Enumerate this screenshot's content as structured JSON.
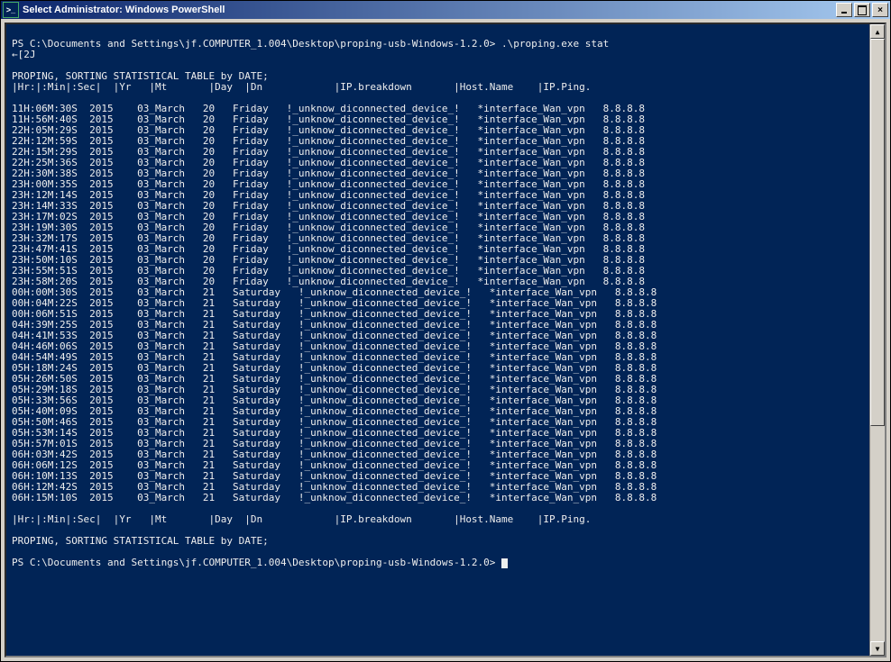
{
  "window": {
    "title": "Select Administrator: Windows PowerShell",
    "icon_text": ">_"
  },
  "prompt1": "PS C:\\Documents and Settings\\jf.COMPUTER_1.004\\Desktop\\proping-usb-Windows-1.2.0> .\\proping.exe stat",
  "esc": "←[2J",
  "header": "PROPING, SORTING STATISTICAL TABLE by DATE;",
  "colhdr": "|Hr:|:Min|:Sec|  |Yr   |Mt       |Day  |Dn            |IP.breakdown       |Host.Name    |IP.Ping.",
  "rows_friday": [
    {
      "t": "11H:06M:30S",
      "y": "2015",
      "m": "03_March",
      "d": "20",
      "dn": "Friday",
      "bd": "!_unknow_diconnected_device_!",
      "hn": "*interface_Wan_vpn",
      "ip": "8.8.8.8"
    },
    {
      "t": "11H:56M:40S",
      "y": "2015",
      "m": "03_March",
      "d": "20",
      "dn": "Friday",
      "bd": "!_unknow_diconnected_device_!",
      "hn": "*interface_Wan_vpn",
      "ip": "8.8.8.8"
    },
    {
      "t": "22H:05M:29S",
      "y": "2015",
      "m": "03_March",
      "d": "20",
      "dn": "Friday",
      "bd": "!_unknow_diconnected_device_!",
      "hn": "*interface_Wan_vpn",
      "ip": "8.8.8.8"
    },
    {
      "t": "22H:12M:59S",
      "y": "2015",
      "m": "03_March",
      "d": "20",
      "dn": "Friday",
      "bd": "!_unknow_diconnected_device_!",
      "hn": "*interface_Wan_vpn",
      "ip": "8.8.8.8"
    },
    {
      "t": "22H:15M:29S",
      "y": "2015",
      "m": "03_March",
      "d": "20",
      "dn": "Friday",
      "bd": "!_unknow_diconnected_device_!",
      "hn": "*interface_Wan_vpn",
      "ip": "8.8.8.8"
    },
    {
      "t": "22H:25M:36S",
      "y": "2015",
      "m": "03_March",
      "d": "20",
      "dn": "Friday",
      "bd": "!_unknow_diconnected_device_!",
      "hn": "*interface_Wan_vpn",
      "ip": "8.8.8.8"
    },
    {
      "t": "22H:30M:38S",
      "y": "2015",
      "m": "03_March",
      "d": "20",
      "dn": "Friday",
      "bd": "!_unknow_diconnected_device_!",
      "hn": "*interface_Wan_vpn",
      "ip": "8.8.8.8"
    },
    {
      "t": "23H:00M:35S",
      "y": "2015",
      "m": "03_March",
      "d": "20",
      "dn": "Friday",
      "bd": "!_unknow_diconnected_device_!",
      "hn": "*interface_Wan_vpn",
      "ip": "8.8.8.8"
    },
    {
      "t": "23H:12M:14S",
      "y": "2015",
      "m": "03_March",
      "d": "20",
      "dn": "Friday",
      "bd": "!_unknow_diconnected_device_!",
      "hn": "*interface_Wan_vpn",
      "ip": "8.8.8.8"
    },
    {
      "t": "23H:14M:33S",
      "y": "2015",
      "m": "03_March",
      "d": "20",
      "dn": "Friday",
      "bd": "!_unknow_diconnected_device_!",
      "hn": "*interface_Wan_vpn",
      "ip": "8.8.8.8"
    },
    {
      "t": "23H:17M:02S",
      "y": "2015",
      "m": "03_March",
      "d": "20",
      "dn": "Friday",
      "bd": "!_unknow_diconnected_device_!",
      "hn": "*interface_Wan_vpn",
      "ip": "8.8.8.8"
    },
    {
      "t": "23H:19M:30S",
      "y": "2015",
      "m": "03_March",
      "d": "20",
      "dn": "Friday",
      "bd": "!_unknow_diconnected_device_!",
      "hn": "*interface_Wan_vpn",
      "ip": "8.8.8.8"
    },
    {
      "t": "23H:32M:17S",
      "y": "2015",
      "m": "03_March",
      "d": "20",
      "dn": "Friday",
      "bd": "!_unknow_diconnected_device_!",
      "hn": "*interface_Wan_vpn",
      "ip": "8.8.8.8"
    },
    {
      "t": "23H:47M:41S",
      "y": "2015",
      "m": "03_March",
      "d": "20",
      "dn": "Friday",
      "bd": "!_unknow_diconnected_device_!",
      "hn": "*interface_Wan_vpn",
      "ip": "8.8.8.8"
    },
    {
      "t": "23H:50M:10S",
      "y": "2015",
      "m": "03_March",
      "d": "20",
      "dn": "Friday",
      "bd": "!_unknow_diconnected_device_!",
      "hn": "*interface_Wan_vpn",
      "ip": "8.8.8.8"
    },
    {
      "t": "23H:55M:51S",
      "y": "2015",
      "m": "03_March",
      "d": "20",
      "dn": "Friday",
      "bd": "!_unknow_diconnected_device_!",
      "hn": "*interface_Wan_vpn",
      "ip": "8.8.8.8"
    },
    {
      "t": "23H:58M:20S",
      "y": "2015",
      "m": "03_March",
      "d": "20",
      "dn": "Friday",
      "bd": "!_unknow_diconnected_device_!",
      "hn": "*interface_Wan_vpn",
      "ip": "8.8.8.8"
    }
  ],
  "rows_saturday": [
    {
      "t": "00H:00M:30S",
      "y": "2015",
      "m": "03_March",
      "d": "21",
      "dn": "Saturday",
      "bd": "!_unknow_diconnected_device_!",
      "hn": "*interface_Wan_vpn",
      "ip": "8.8.8.8"
    },
    {
      "t": "00H:04M:22S",
      "y": "2015",
      "m": "03_March",
      "d": "21",
      "dn": "Saturday",
      "bd": "!_unknow_diconnected_device_!",
      "hn": "*interface_Wan_vpn",
      "ip": "8.8.8.8"
    },
    {
      "t": "00H:06M:51S",
      "y": "2015",
      "m": "03_March",
      "d": "21",
      "dn": "Saturday",
      "bd": "!_unknow_diconnected_device_!",
      "hn": "*interface_Wan_vpn",
      "ip": "8.8.8.8"
    },
    {
      "t": "04H:39M:25S",
      "y": "2015",
      "m": "03_March",
      "d": "21",
      "dn": "Saturday",
      "bd": "!_unknow_diconnected_device_!",
      "hn": "*interface_Wan_vpn",
      "ip": "8.8.8.8"
    },
    {
      "t": "04H:41M:53S",
      "y": "2015",
      "m": "03_March",
      "d": "21",
      "dn": "Saturday",
      "bd": "!_unknow_diconnected_device_!",
      "hn": "*interface_Wan_vpn",
      "ip": "8.8.8.8"
    },
    {
      "t": "04H:46M:06S",
      "y": "2015",
      "m": "03_March",
      "d": "21",
      "dn": "Saturday",
      "bd": "!_unknow_diconnected_device_!",
      "hn": "*interface_Wan_vpn",
      "ip": "8.8.8.8"
    },
    {
      "t": "04H:54M:49S",
      "y": "2015",
      "m": "03_March",
      "d": "21",
      "dn": "Saturday",
      "bd": "!_unknow_diconnected_device_!",
      "hn": "*interface_Wan_vpn",
      "ip": "8.8.8.8"
    },
    {
      "t": "05H:18M:24S",
      "y": "2015",
      "m": "03_March",
      "d": "21",
      "dn": "Saturday",
      "bd": "!_unknow_diconnected_device_!",
      "hn": "*interface_Wan_vpn",
      "ip": "8.8.8.8"
    },
    {
      "t": "05H:26M:50S",
      "y": "2015",
      "m": "03_March",
      "d": "21",
      "dn": "Saturday",
      "bd": "!_unknow_diconnected_device_!",
      "hn": "*interface_Wan_vpn",
      "ip": "8.8.8.8"
    },
    {
      "t": "05H:29M:18S",
      "y": "2015",
      "m": "03_March",
      "d": "21",
      "dn": "Saturday",
      "bd": "!_unknow_diconnected_device_!",
      "hn": "*interface_Wan_vpn",
      "ip": "8.8.8.8"
    },
    {
      "t": "05H:33M:56S",
      "y": "2015",
      "m": "03_March",
      "d": "21",
      "dn": "Saturday",
      "bd": "!_unknow_diconnected_device_!",
      "hn": "*interface_Wan_vpn",
      "ip": "8.8.8.8"
    },
    {
      "t": "05H:40M:09S",
      "y": "2015",
      "m": "03_March",
      "d": "21",
      "dn": "Saturday",
      "bd": "!_unknow_diconnected_device_!",
      "hn": "*interface_Wan_vpn",
      "ip": "8.8.8.8"
    },
    {
      "t": "05H:50M:46S",
      "y": "2015",
      "m": "03_March",
      "d": "21",
      "dn": "Saturday",
      "bd": "!_unknow_diconnected_device_!",
      "hn": "*interface_Wan_vpn",
      "ip": "8.8.8.8"
    },
    {
      "t": "05H:53M:14S",
      "y": "2015",
      "m": "03_March",
      "d": "21",
      "dn": "Saturday",
      "bd": "!_unknow_diconnected_device_!",
      "hn": "*interface_Wan_vpn",
      "ip": "8.8.8.8"
    },
    {
      "t": "05H:57M:01S",
      "y": "2015",
      "m": "03_March",
      "d": "21",
      "dn": "Saturday",
      "bd": "!_unknow_diconnected_device_!",
      "hn": "*interface_Wan_vpn",
      "ip": "8.8.8.8"
    },
    {
      "t": "06H:03M:42S",
      "y": "2015",
      "m": "03_March",
      "d": "21",
      "dn": "Saturday",
      "bd": "!_unknow_diconnected_device_!",
      "hn": "*interface_Wan_vpn",
      "ip": "8.8.8.8"
    },
    {
      "t": "06H:06M:12S",
      "y": "2015",
      "m": "03_March",
      "d": "21",
      "dn": "Saturday",
      "bd": "!_unknow_diconnected_device_!",
      "hn": "*interface_Wan_vpn",
      "ip": "8.8.8.8"
    },
    {
      "t": "06H:10M:13S",
      "y": "2015",
      "m": "03_March",
      "d": "21",
      "dn": "Saturday",
      "bd": "!_unknow_diconnected_device_!",
      "hn": "*interface_Wan_vpn",
      "ip": "8.8.8.8"
    },
    {
      "t": "06H:12M:42S",
      "y": "2015",
      "m": "03_March",
      "d": "21",
      "dn": "Saturday",
      "bd": "!_unknow_diconnected_device_!",
      "hn": "*interface_Wan_vpn",
      "ip": "8.8.8.8"
    },
    {
      "t": "06H:15M:10S",
      "y": "2015",
      "m": "03_March",
      "d": "21",
      "dn": "Saturday",
      "bd": "!_unknow_diconnected_device_!",
      "hn": "*interface_Wan_vpn",
      "ip": "8.8.8.8"
    }
  ],
  "prompt2": "PS C:\\Documents and Settings\\jf.COMPUTER_1.004\\Desktop\\proping-usb-Windows-1.2.0> "
}
